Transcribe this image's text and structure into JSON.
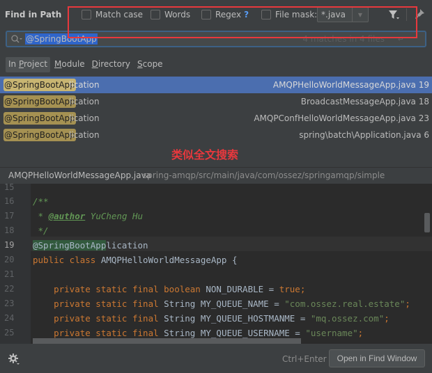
{
  "dialog": {
    "title": "Find in Path"
  },
  "options": {
    "match_case": {
      "label": "Match case",
      "checked": false
    },
    "words": {
      "label": "Words",
      "checked": false
    },
    "regex": {
      "label": "Regex",
      "help": "?",
      "checked": false
    },
    "file_mask": {
      "label": "File mask:",
      "checked": false,
      "value": "*.java"
    }
  },
  "search": {
    "query": "@SpringBootApp",
    "match_count": "4 matches in 4 files"
  },
  "scope_tabs": [
    {
      "prefix": "In ",
      "mnemonic": "P",
      "suffix": "roject",
      "active": true
    },
    {
      "prefix": "",
      "mnemonic": "M",
      "suffix": "odule",
      "active": false
    },
    {
      "prefix": "",
      "mnemonic": "D",
      "suffix": "irectory",
      "active": false
    },
    {
      "prefix": "",
      "mnemonic": "S",
      "suffix": "cope",
      "active": false
    }
  ],
  "results": [
    {
      "match": "@SpringBootApp",
      "rest": "lication",
      "file": "AMQPHelloWorldMessageApp.java 19",
      "selected": true
    },
    {
      "match": "@SpringBootApp",
      "rest": "lication",
      "file": "BroadcastMessageApp.java 18",
      "selected": false
    },
    {
      "match": "@SpringBootApp",
      "rest": "lication",
      "file": "AMQPConfHelloWorldMessageApp.java 23",
      "selected": false
    },
    {
      "match": "@SpringBootApp",
      "rest": "lication",
      "file": "spring\\batch\\Application.java 6",
      "selected": false
    }
  ],
  "annotation": "类似全文搜索",
  "preview": {
    "file_name": "AMQPHelloWorldMessageApp.java",
    "path": "spring-amqp/src/main/java/com/ossez/springamqp/simple",
    "current_line": "19",
    "lines": {
      "n15": "15",
      "n16": "16",
      "n17": "17",
      "n18": "18",
      "n19": "19",
      "n20": "20",
      "n21": "21",
      "n22": "22",
      "n23": "23",
      "n24": "24",
      "n25": "25"
    },
    "code": {
      "l16": "/**",
      "l17_star": " * ",
      "l17_tag": "@author",
      "l17_name": " YuCheng Hu",
      "l18": " */",
      "l19_match": "@SpringBootApp",
      "l19_rest": "lication",
      "l20_kw": "public class ",
      "l20_name": "AMQPHelloWorldMessageApp {",
      "l22_kw": "    private static final boolean ",
      "l22_name": "NON_DURABLE = ",
      "l22_val": "true",
      "l22_end": ";",
      "l23_kw": "    private static final ",
      "l23_type": "String MY_QUEUE_NAME = ",
      "l23_val": "\"com.ossez.real.estate\"",
      "l23_end": ";",
      "l24_kw": "    private static final ",
      "l24_type": "String MY_QUEUE_HOSTMANME = ",
      "l24_val": "\"mq.ossez.com\"",
      "l24_end": ";",
      "l25_kw": "    private static final ",
      "l25_type": "String MY_QUEUE_USERNAME = ",
      "l25_val": "\"username\"",
      "l25_end": ";"
    }
  },
  "footer": {
    "shortcut": "Ctrl+Enter",
    "open_button": "Open in Find Window"
  },
  "colors": {
    "accent_selection": "#4b6eaf",
    "annotation_red": "#e8383d",
    "match_highlight": "#a59152"
  }
}
